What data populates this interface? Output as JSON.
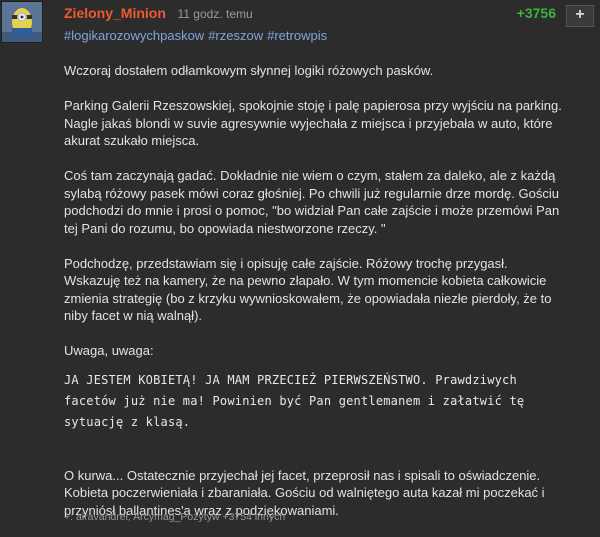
{
  "entry": {
    "author": "Zielony_Minion",
    "time": "11 godz. temu",
    "votes": "+3756",
    "plus_label": "+",
    "tags": [
      "#logikarozowychpaskow",
      "#rzeszow",
      "#retrowpis"
    ],
    "paragraphs": [
      "Wczoraj dostałem odłamkowym słynnej logiki różowych pasków.",
      "Parking Galerii Rzeszowskiej, spokojnie stoję i palę papierosa przy wyjściu na parking. Nagle jakaś blondi w suvie agresywnie wyjechała z miejsca i przyjebała w auto, które akurat szukało miejsca.",
      "Coś tam zaczynają gadać. Dokładnie nie wiem o czym, stałem za daleko, ale z każdą sylabą różowy pasek mówi coraz głośniej. Po chwili już regularnie drze mordę. Gościu podchodzi do mnie i prosi o pomoc, \"bo widział Pan całe zajście i może przemówi Pan tej Pani do rozumu, bo opowiada niestworzone rzeczy. \"",
      "Podchodzę, przedstawiam się i opisuję całe zajście. Różowy trochę przygasł. Wskazuję też na kamery, że na pewno złapało. W tym momencie kobieta całkowicie zmienia strategię (bo z krzyku wywnioskowałem, że opowiadała niezłe pierdoły, że to niby facet w nią walnął).",
      "Uwaga, uwaga:"
    ],
    "quote": "JA JESTEM KOBIETĄ! JA MAM PRZECIEŻ PIERWSZEŃSTWO. Prawdziwych facetów już nie ma! Powinien być Pan gentlemanem i załatwić tę sytuację z klasą.",
    "final_paragraph": "O kurwa... Ostatecznie przyjechał jej facet, przeprosił nas i spisali to oświadczenie. Kobieta poczerwieniała i zbaraniała. Gościu od walniętego auta kazał mi poczekać i przyniósł ballantines'a wraz z podziękowaniami.",
    "voters": "+: airavandrel, Arcymag_Pozytyw +3754 innych"
  }
}
